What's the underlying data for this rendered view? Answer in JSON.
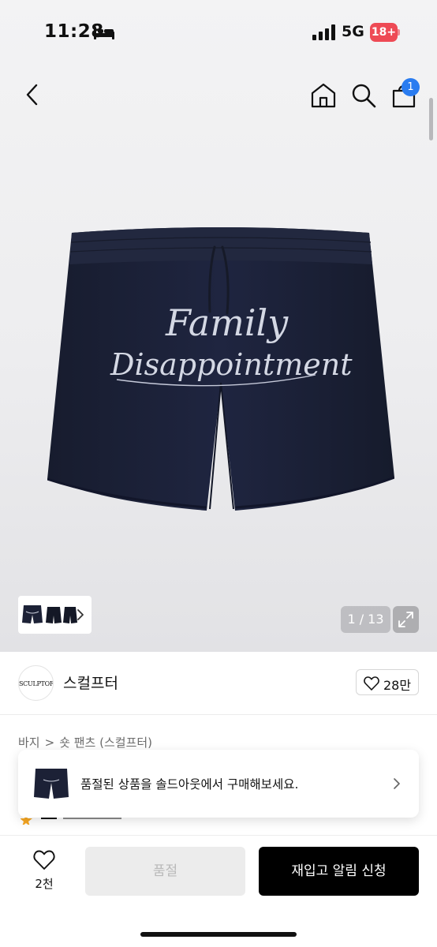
{
  "status_bar": {
    "time": "11:28",
    "network": "5G",
    "battery": "18+"
  },
  "header": {
    "cart_count": "1"
  },
  "gallery": {
    "graphic_text_line1": "Family",
    "graphic_text_line2": "Disappointment",
    "counter": "1 / 13"
  },
  "brand": {
    "logo_text": "SCULPTOR",
    "name": "스컬프터",
    "likes": "28만"
  },
  "breadcrumb": {
    "category": "바지",
    "separator": ">",
    "subcategory": "숏 팬츠 (스컬프터)"
  },
  "soldout_banner": {
    "text": "품절된 상품을 솔드아웃에서 구매해보세요."
  },
  "bottom_bar": {
    "wish_count": "2천",
    "soldout_label": "품절",
    "restock_label": "재입고 알림 신청"
  },
  "colors": {
    "accent_blue": "#2a7cf0",
    "battery_red": "#ee4a55",
    "shorts_navy": "#1b2136",
    "restock_button": "#000000"
  }
}
